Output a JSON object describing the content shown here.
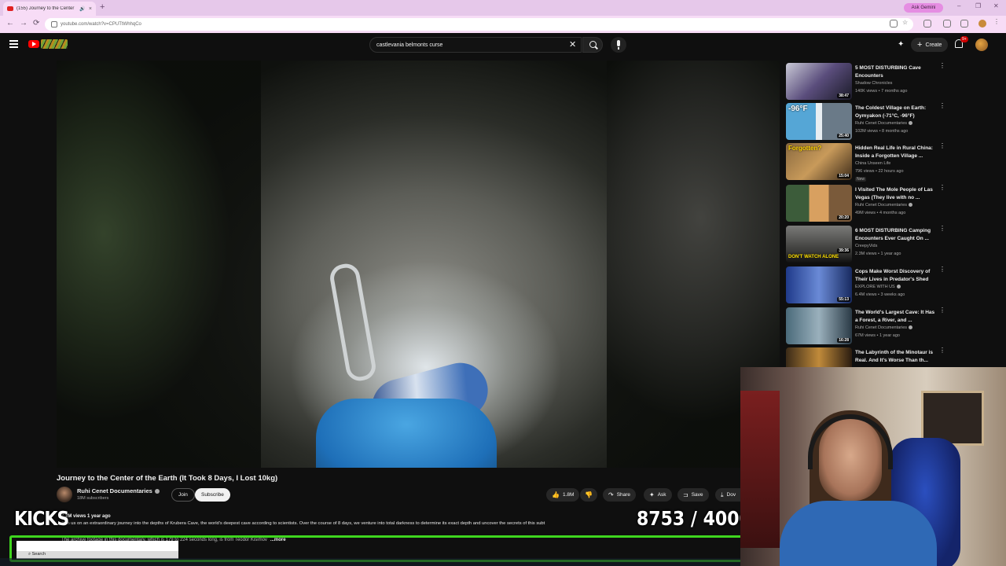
{
  "browser": {
    "tab_title": "(155) Journey to the Center",
    "tab_close": "×",
    "new_tab": "+",
    "address": "youtube.com/watch?v=CPUTtWhhqCo",
    "gemini_label": "Ask Gemini",
    "minimize": "–",
    "restore": "❐",
    "close": "✕"
  },
  "header": {
    "search_query": "castlevania belmonts curse",
    "create_label": "Create",
    "notifications_badge": "9+"
  },
  "video": {
    "title": "Journey to the Center of the Earth (It Took 8 Days, I Lost 10kg)",
    "channel": "Ruhi Cenet Documentaries",
    "subscribers": "18M subscribers",
    "join_label": "Join",
    "subscribe_label": "Subscribe",
    "likes": "1.8M",
    "share_label": "Share",
    "ask_label": "Ask",
    "save_label": "Save",
    "download_label": "Dov",
    "views_line": "7.2M views  1 year ago",
    "description": "Join us on an extraordinary journey into the depths of Krubera Cave, the world's deepest cave according to scientists. Over the course of 8 days, we venture into total darkness to determine its exact depth and uncover the secrets of this subt",
    "description_line2": "The archive footage in this documentary, which is 179 to 224 seconds long, is from Teodor Kisimov",
    "more_label": "...more"
  },
  "overlay": {
    "kicks_label": "KICKS",
    "kicks_count": "8753  / 40000",
    "kicks_current": 8753,
    "kicks_goal": 40000,
    "taskbar_search": "Search"
  },
  "recommendations": [
    {
      "title": "5 MOST DISTURBING Cave Encounters",
      "channel": "Shadow Chronicles",
      "verified": false,
      "meta": "140K views • 7 months ago",
      "duration": "38:47",
      "thumb_text": ""
    },
    {
      "title": "The Coldest Village on Earth: Oymyakon (-71°C, -96°F)",
      "channel": "Ruhi Cenet Documentaries",
      "verified": true,
      "meta": "102M views • 8 months ago",
      "duration": "25:40",
      "thumb_text": "-96°F"
    },
    {
      "title": "Hidden Real Life in Rural China: Inside a Forgotten Village ...",
      "channel": "China Unseen Life",
      "verified": false,
      "meta": "796 views • 22 hours ago",
      "duration": "15:04",
      "thumb_text": "Forgotten?",
      "badge": "New"
    },
    {
      "title": "I Visited The Mole People of Las Vegas (They live with no ...",
      "channel": "Ruhi Cenet Documentaries",
      "verified": true,
      "meta": "49M views • 4 months ago",
      "duration": "20:20",
      "thumb_text": ""
    },
    {
      "title": "6 MOST DISTURBING Camping Encounters Ever Caught On ...",
      "channel": "CreepyVids",
      "verified": false,
      "meta": "2.3M views • 1 year ago",
      "duration": "39:36",
      "thumb_text": "DON'T WATCH ALONE"
    },
    {
      "title": "Cops Make Worst Discovery of Their Lives in Predator's Shed",
      "channel": "EXPLORE WITH US",
      "verified": true,
      "meta": "6.4M views • 3 weeks ago",
      "duration": "55:13",
      "thumb_text": ""
    },
    {
      "title": "The World's Largest Cave: It Has a Forest, a River, and ...",
      "channel": "Ruhi Cenet Documentaries",
      "verified": true,
      "meta": "67M views • 1 year ago",
      "duration": "16:28",
      "thumb_text": ""
    },
    {
      "title": "The Labyrinth of the Minotaur is Real. And It's Worse Than th...",
      "channel": "",
      "verified": false,
      "meta": "",
      "duration": "",
      "thumb_text": ""
    }
  ],
  "icons": {
    "back": "arrow-left-icon",
    "forward": "arrow-right-icon",
    "reload": "reload-icon",
    "like": "thumbs-up-icon",
    "dislike": "thumbs-down-icon"
  },
  "colors": {
    "brand_red": "#ff0000",
    "overlay_green": "#3fd61f",
    "browser_pink": "#f7dcf6"
  }
}
